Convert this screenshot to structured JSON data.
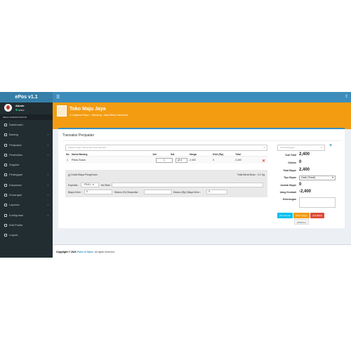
{
  "app": {
    "title": "ePos v1.1"
  },
  "user": {
    "name": "Admin",
    "status": "Online"
  },
  "menu": {
    "header": "MENU ADMINISTRATOR",
    "items": [
      {
        "label": "Dashboard",
        "icon": "dashboard-icon",
        "has_sub": false
      },
      {
        "label": "Barang",
        "icon": "box-icon",
        "has_sub": true
      },
      {
        "label": "Penjualan",
        "icon": "cart-icon",
        "has_sub": true
      },
      {
        "label": "Pembelian",
        "icon": "truck-icon",
        "has_sub": true
      },
      {
        "label": "Supplier",
        "icon": "supplier-icon",
        "has_sub": false
      },
      {
        "label": "Pelanggan",
        "icon": "users-icon",
        "has_sub": true
      },
      {
        "label": "Karyawan",
        "icon": "employee-icon",
        "has_sub": true
      },
      {
        "label": "Keuangan",
        "icon": "money-icon",
        "has_sub": true
      },
      {
        "label": "Laporan",
        "icon": "report-icon",
        "has_sub": true
      },
      {
        "label": "Konfigurasi",
        "icon": "gear-icon",
        "has_sub": true
      },
      {
        "label": "Edit Profile",
        "icon": "user-icon",
        "has_sub": false
      },
      {
        "label": "Logout",
        "icon": "power-icon",
        "has_sub": false
      }
    ]
  },
  "store": {
    "name": "Toko Maju Jaya",
    "address": "Jl. Angkasa Raya I - Bandung, Jawa Barat, Indonesia"
  },
  "page": {
    "section_title": "Transaksi Penjualan"
  },
  "search": {
    "placeholder": "Ketikan Kode / Nama atau scan barcode..."
  },
  "table": {
    "columns": [
      "No",
      "Nama Barang",
      "Jml",
      "Sat",
      "Harga",
      "Disk (Rp)",
      "Total"
    ],
    "rows": [
      {
        "no": "1",
        "name": "Pillow Snack",
        "qty": "1",
        "unit": "pk",
        "price": "2,400",
        "disc": "0",
        "total": "2,400"
      }
    ]
  },
  "shipping": {
    "checkbox_label": "Gratis Biaya Pengiriman",
    "total_weight": "Total Berat Bruto : 0.1 Kg",
    "expedisi_label": "Expedisi :",
    "expedisi_value": "- PILIH -",
    "noresi_label": "No Resi :",
    "biaya_kirim_label": "Biaya Kirim :",
    "biaya_kirim_value": "0",
    "diskon_pct_label": "Diskon (%) Ekspedisi :",
    "diskon_rp_label": "Diskon (Rp) Biaya Kirim :",
    "diskon_rp_value": "0"
  },
  "summary": {
    "customer_placeholder": "Cari Pelanggan",
    "sub_total_label": "Sub Total",
    "sub_total": "2,400",
    "diskon_label": "Diskon",
    "diskon": "0",
    "total_bayar_label": "Total Bayar",
    "total_bayar": "2,400",
    "tipe_bayar_label": "Tipe Bayar",
    "tipe_bayar": "Cash (Tunai)",
    "jumlah_bayar_label": "Jumlah Bayar",
    "jumlah_bayar": "0",
    "uang_kembali_label": "Uang Kembali",
    "uang_kembali": "-2,400",
    "keterangan_label": "Keterangan"
  },
  "buttons": {
    "simpan": "[F2] Simpan",
    "tunggu": "[F3] Tunggu",
    "batal": "[F4] Batal",
    "print": "[F5] Print"
  },
  "footer": {
    "copyright": "Copyright © 2021",
    "link": "Point of Sales.",
    "rights": "All rights reserved."
  },
  "colors": {
    "sidebar": "#222d32",
    "topbar": "#3c8dbc",
    "store_header": "#f39c12",
    "simpan": "#00c0ef",
    "tunggu": "#f39c12",
    "batal": "#dd4b39"
  }
}
